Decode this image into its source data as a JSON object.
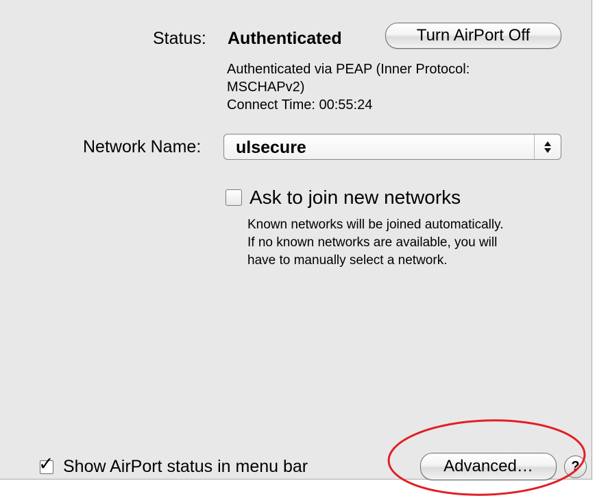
{
  "status": {
    "label": "Status:",
    "value": "Authenticated",
    "toggle_button": "Turn AirPort Off",
    "details": [
      "Authenticated via PEAP (Inner Protocol:",
      "MSCHAPv2)",
      "Connect Time: 00:55:24"
    ]
  },
  "network": {
    "label": "Network Name:",
    "selected": "ulsecure"
  },
  "ask_join": {
    "checked": false,
    "label": "Ask to join new networks",
    "help_lines": [
      "Known networks will be joined automatically.",
      "If no known networks are available, you will",
      "have to manually select a network."
    ]
  },
  "footer": {
    "show_status_checked": true,
    "show_status_label": "Show AirPort status in menu bar",
    "advanced_button": "Advanced…",
    "help_button": "?"
  },
  "colors": {
    "pane_background": "#e8e8e8",
    "annotation_circle": "#e31e24"
  },
  "icons": {
    "checkmark": "checkmark-icon",
    "select_arrows": "updown-chevron-icon",
    "help": "question-mark-icon"
  }
}
